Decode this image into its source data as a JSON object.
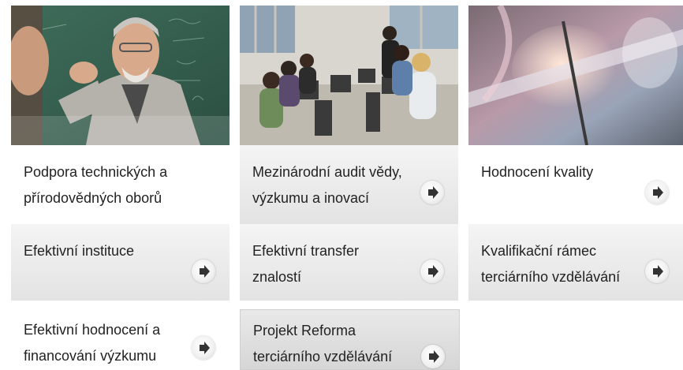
{
  "tiles": [
    {
      "label_lines": [
        "Podpora technických a",
        "přírodovědných oborů"
      ],
      "arrow_icon": ""
    },
    {
      "label_lines": [
        "Mezinárodní audit vědy,",
        "výzkumu a inovací"
      ],
      "arrow_icon": "arrow-right-circle"
    },
    {
      "label_lines": [
        "Hodnocení kvality"
      ],
      "arrow_icon": "arrow-right-circle"
    },
    {
      "label_lines": [
        "Efektivní instituce"
      ],
      "arrow_icon": "arrow-right-circle"
    },
    {
      "label_lines": [
        "Efektivní transfer",
        "znalostí"
      ],
      "arrow_icon": "arrow-right-circle"
    },
    {
      "label_lines": [
        "Kvalifikační rámec",
        "terciárního vzdělávání"
      ],
      "arrow_icon": "arrow-right-circle"
    },
    {
      "label_lines": [
        "Efektivní hodnocení a",
        "financování výzkumu"
      ],
      "arrow_icon": "arrow-right-circle"
    },
    {
      "label_lines": [
        "Projekt Reforma",
        "terciárního vzdělávání"
      ],
      "arrow_icon": "arrow-right-circle"
    }
  ],
  "colors": {
    "tile_text": "#222222",
    "tile_bg_grey": "#e3e3e3",
    "tile_highlight": "#d6d6d6"
  }
}
